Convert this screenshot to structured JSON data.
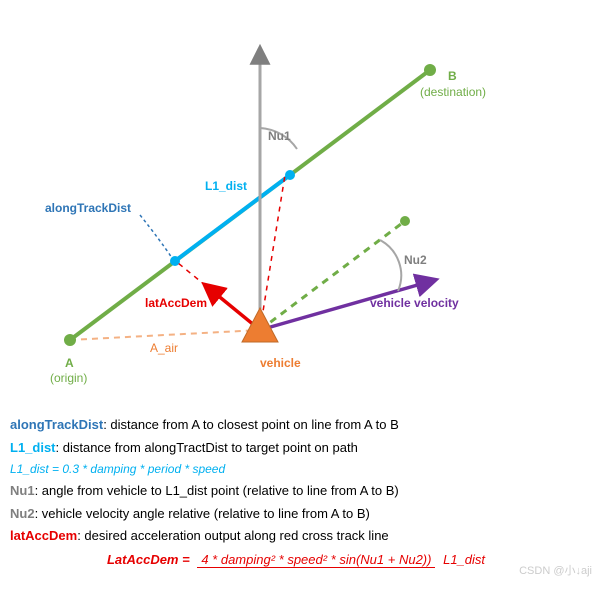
{
  "diagram": {
    "A": "A",
    "A_sub": "(origin)",
    "B": "B",
    "B_sub": "(destination)",
    "vehicle": "vehicle",
    "vel": "vehicle velocity",
    "latAccDem": "latAccDem",
    "L1_dist": "L1_dist",
    "alongTrackDist": "alongTrackDist",
    "A_air": "A_air",
    "Nu1": "Nu1",
    "Nu2": "Nu2"
  },
  "legend": {
    "alongTrackDist_key": "alongTrackDist",
    "alongTrackDist": ": distance from A to closest point on line from A to B",
    "L1_dist_key": "L1_dist",
    "L1_dist": ": distance from alongTractDist to target point on path",
    "L1_formula": "L1_dist = 0.3  * damping  * period  * speed",
    "Nu1_key": "Nu1",
    "Nu1": ": angle from vehicle to L1_dist point (relative to line from A to B)",
    "Nu2_key": "Nu2",
    "Nu2": ": vehicle velocity angle relative (relative to line from A to B)",
    "latAccDem_key": "latAccDem",
    "latAccDem": ": desired acceleration output along red cross track line",
    "latFormula_lhs": "LatAccDem =",
    "latFormula_num": "4 * damping² * speed² * sin(Nu1 + Nu2))",
    "latFormula_den": "L1_dist"
  },
  "watermark": "CSDN @小↓aji"
}
